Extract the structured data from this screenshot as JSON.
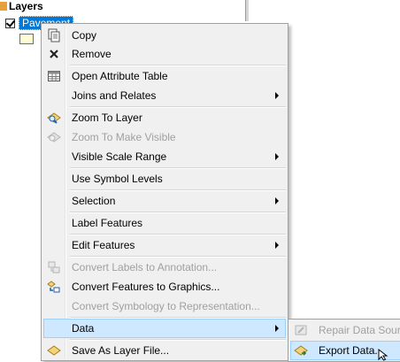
{
  "toc": {
    "title": "Layers",
    "layer_name": "Pavement"
  },
  "menu": {
    "items": [
      {
        "label": "Copy",
        "icon": "copy-icon",
        "enabled": true
      },
      {
        "label": "Remove",
        "icon": "remove-x-icon",
        "enabled": true
      },
      {
        "label": "Open Attribute Table",
        "icon": "table-icon",
        "enabled": true
      },
      {
        "label": "Joins and Relates",
        "enabled": true,
        "submenu": true
      },
      {
        "label": "Zoom To Layer",
        "icon": "zoom-to-layer-icon",
        "enabled": true
      },
      {
        "label": "Zoom To Make Visible",
        "icon": "zoom-to-visible-icon",
        "enabled": false
      },
      {
        "label": "Visible Scale Range",
        "enabled": true,
        "submenu": true
      },
      {
        "label": "Use Symbol Levels",
        "enabled": true
      },
      {
        "label": "Selection",
        "enabled": true,
        "submenu": true
      },
      {
        "label": "Label Features",
        "enabled": true
      },
      {
        "label": "Edit Features",
        "enabled": true,
        "submenu": true
      },
      {
        "label": "Convert Labels to Annotation...",
        "icon": "convert-labels-icon",
        "enabled": false
      },
      {
        "label": "Convert Features to Graphics...",
        "icon": "convert-graphics-icon",
        "enabled": true
      },
      {
        "label": "Convert Symbology to Representation...",
        "enabled": false
      },
      {
        "label": "Data",
        "enabled": true,
        "submenu": true,
        "highlighted": true
      },
      {
        "label": "Save As Layer File...",
        "icon": "save-layer-icon",
        "enabled": true
      }
    ]
  },
  "submenu": {
    "items": [
      {
        "label": "Repair Data Sourc",
        "icon": "repair-data-icon",
        "enabled": false
      },
      {
        "label": "Export Data...",
        "icon": "export-data-icon",
        "enabled": true,
        "highlighted": true
      }
    ]
  },
  "colors": {
    "selection_blue": "#0078d7",
    "menu_highlight": "#cde8ff",
    "menu_background": "#f0f0f0",
    "disabled_text": "#a0a0a0"
  }
}
